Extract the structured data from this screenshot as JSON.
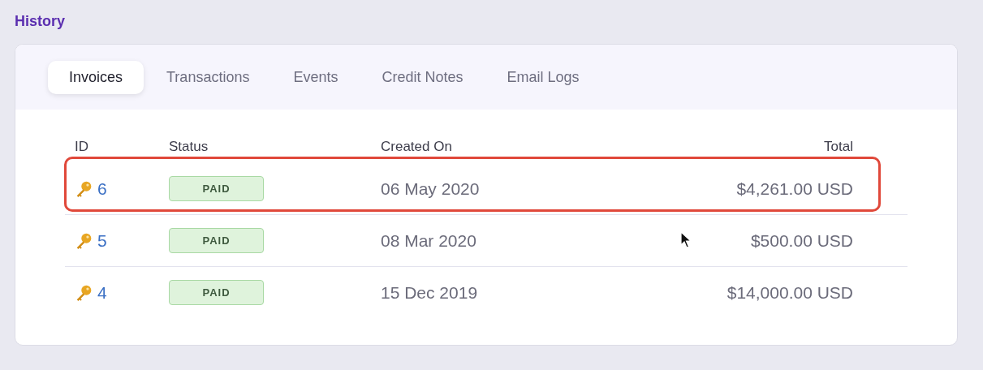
{
  "section_title": "History",
  "tabs": [
    {
      "label": "Invoices",
      "selected": true
    },
    {
      "label": "Transactions",
      "selected": false
    },
    {
      "label": "Events",
      "selected": false
    },
    {
      "label": "Credit Notes",
      "selected": false
    },
    {
      "label": "Email Logs",
      "selected": false
    }
  ],
  "table": {
    "columns": [
      "ID",
      "Status",
      "Created On",
      "Total"
    ],
    "rows": [
      {
        "id": "6",
        "status": "PAID",
        "created_on": "06 May 2020",
        "total": "$4,261.00 USD",
        "highlighted": true
      },
      {
        "id": "5",
        "status": "PAID",
        "created_on": "08 Mar 2020",
        "total": "$500.00 USD",
        "highlighted": false
      },
      {
        "id": "4",
        "status": "PAID",
        "created_on": "15 Dec 2019",
        "total": "$14,000.00 USD",
        "highlighted": false
      }
    ]
  }
}
